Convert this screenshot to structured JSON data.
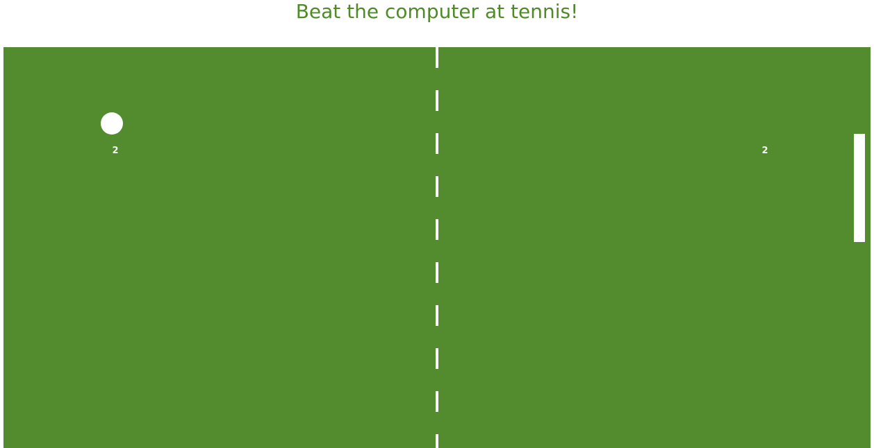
{
  "page": {
    "title": "Beat the computer at tennis!"
  },
  "game": {
    "player_score": "2",
    "computer_score": "2",
    "colors": {
      "court": "#528c2f",
      "title": "#4f8a28",
      "lines": "#ffffff"
    }
  }
}
